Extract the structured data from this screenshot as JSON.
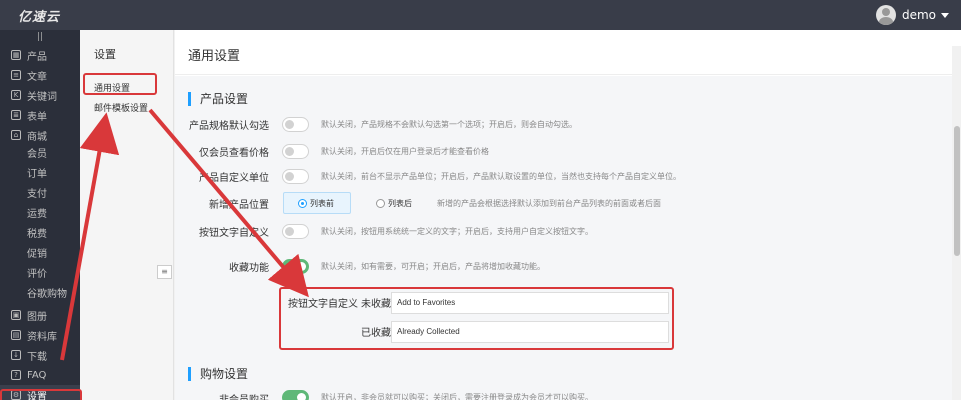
{
  "app": {
    "logo": "亿速云",
    "user": "demo"
  },
  "left_nav": {
    "items": [
      {
        "label": "产品",
        "icon": "grid-icon"
      },
      {
        "label": "文章",
        "icon": "document-icon"
      },
      {
        "label": "关键词",
        "icon": "keyword-icon"
      },
      {
        "label": "表单",
        "icon": "form-icon"
      },
      {
        "label": "商城",
        "icon": "shop-icon"
      }
    ],
    "shop_sub": [
      "会员",
      "订单",
      "支付",
      "运费",
      "税费",
      "促销",
      "评价",
      "谷歌购物"
    ],
    "items_bottom": [
      {
        "label": "图册",
        "icon": "image-icon"
      },
      {
        "label": "资料库",
        "icon": "library-icon"
      },
      {
        "label": "下载",
        "icon": "download-icon"
      },
      {
        "label": "FAQ",
        "icon": "faq-icon"
      },
      {
        "label": "设置",
        "icon": "gear-icon"
      }
    ]
  },
  "submenu": {
    "title": "设置",
    "items": [
      "通用设置",
      "邮件模板设置"
    ]
  },
  "page": {
    "title": "通用设置"
  },
  "sections": {
    "product": {
      "title": "产品设置",
      "rows": [
        {
          "label": "产品规格默认勾选",
          "on": false,
          "hint": "默认关闭，产品规格不会默认勾选第一个选项；开启后，则会自动勾选。"
        },
        {
          "label": "仅会员查看价格",
          "on": false,
          "hint": "默认关闭，开启后仅在用户登录后才能查看价格"
        },
        {
          "label": "产品自定义单位",
          "on": false,
          "hint": "默认关闭，前台不显示产品单位；开启后，产品默认取设置的单位，当然也支持每个产品自定义单位。"
        },
        {
          "label": "新增产品位置",
          "radio": [
            "列表前",
            "列表后"
          ],
          "selected": "列表前",
          "hint": "新增的产品会根据选择默认添加到前台产品列表的前面或者后面"
        },
        {
          "label": "按钮文字自定义",
          "on": false,
          "hint": "默认关闭，按钮用系统统一定义的文字；开启后，支持用户自定义按钮文字。"
        },
        {
          "label": "收藏功能",
          "on": true,
          "hint": "默认关闭，如有需要，可开启；开启后，产品将增加收藏功能。"
        }
      ],
      "button_text": {
        "label": "按钮文字自定义",
        "not_favorited_label": "未收藏",
        "not_favorited_value": "Add to Favorites",
        "favorited_label": "已收藏",
        "favorited_value": "Already Collected"
      }
    },
    "purchase": {
      "title": "购物设置",
      "rows": [
        {
          "label": "非会员购买",
          "on": true,
          "hint": "默认开启，非会员就可以购买；关闭后，需要注册登录成为会员才可以购买。"
        }
      ]
    }
  },
  "colors": {
    "accent": "#1e9fff",
    "switch_on": "#5fb878",
    "annotation": "#d9383a",
    "topbar": "#393d49",
    "sidebar": "#2b2f3a"
  }
}
